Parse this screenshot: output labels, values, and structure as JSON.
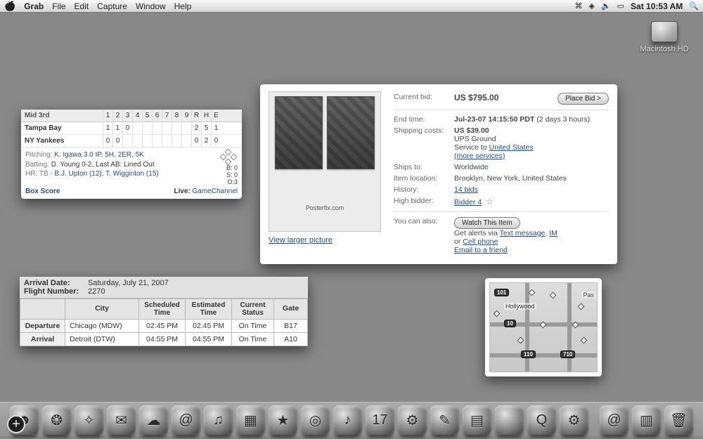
{
  "menubar": {
    "app": "Grab",
    "items": [
      "File",
      "Edit",
      "Capture",
      "Window",
      "Help"
    ],
    "clock": "Sat 10:53 AM"
  },
  "desktop": {
    "hd_label": "Macintosh HD"
  },
  "sports": {
    "status": "Mid 3rd",
    "inning_labels": [
      "1",
      "2",
      "3",
      "4",
      "5",
      "6",
      "7",
      "8",
      "9",
      "R",
      "H",
      "E"
    ],
    "teams": [
      {
        "name": "Tampa Bay",
        "cells": [
          "1",
          "1",
          "0",
          "",
          "",
          "",
          "",
          "",
          "",
          "2",
          "5",
          "1"
        ]
      },
      {
        "name": "NY Yankees",
        "cells": [
          "0",
          "0",
          "",
          "",
          "",
          "",
          "",
          "",
          "",
          "0",
          "2",
          "0"
        ]
      }
    ],
    "bso": {
      "b": "B: 0",
      "s": "S: 0",
      "o": "O:3"
    },
    "pitching_label": "Pitching:",
    "pitching": "K. Igawa 3.0 IP, 5H, 2ER, 5K",
    "batting_label": "Batting:",
    "batting": "D. Young 0-2, Last AB: Lined Out",
    "hr_label": "HR: TB -",
    "hr": "B.J. Upton (12), T. Wigginton (15)",
    "boxscore": "Box Score",
    "live_label": "Live:",
    "live_link": "GameChannel"
  },
  "auction": {
    "poster_caption": "Posterfix.com",
    "view_larger": "View larger picture",
    "currentbid_label": "Current bid:",
    "currentbid": "US $795.00",
    "placebid": "Place Bid >",
    "end_label": "End time:",
    "end_value": "Jul-23-07 14:15:50 PDT",
    "end_remaining": "(2 days 3 hours)",
    "ship_label": "Shipping costs:",
    "ship_cost": "US $39.00",
    "ship_svc": "UPS Ground",
    "ship_to_label": "Service to",
    "ship_to_link": "United States",
    "more_svc": "(more services)",
    "shipsto_label": "Ships to:",
    "shipsto": "Worldwide",
    "loc_label": "Item location:",
    "loc": "Brooklyn, New York, United States",
    "history_label": "History:",
    "history": "14 bids",
    "high_label": "High bidder:",
    "high": "Bidder 4",
    "also_label": "You can also:",
    "watch": "Watch This Item",
    "alerts_a": "Get alerts via ",
    "alerts_text": "Text message",
    "alerts_sep": ", ",
    "alerts_im": "IM",
    "alerts_or": "or ",
    "alerts_cell": "Cell phone",
    "email_friend": "Email to a friend"
  },
  "flight": {
    "date_label": "Arrival Date:",
    "date": "Saturday, July 21, 2007",
    "num_label": "Flight Number:",
    "num": "2270",
    "cols": [
      "",
      "City",
      "Scheduled Time",
      "Estimated Time",
      "Current Status",
      "Gate"
    ],
    "rows": [
      {
        "hdr": "Departure",
        "city": "Chicago (MDW)",
        "sched": "02:45 PM",
        "est": "02:45 PM",
        "status": "On Time",
        "gate": "B17"
      },
      {
        "hdr": "Arrival",
        "city": "Detroit (DTW)",
        "sched": "04:55 PM",
        "est": "04:55 PM",
        "status": "On Time",
        "gate": "A10"
      }
    ]
  },
  "map": {
    "labels": {
      "hollywood": "Hollywood",
      "pas": "Pas"
    },
    "shields": {
      "s101": "101",
      "s10": "10",
      "s110": "110",
      "s710": "710"
    }
  },
  "dock": {
    "apps": [
      {
        "n": "finder",
        "g": "☻"
      },
      {
        "n": "dashboard",
        "g": "❂"
      },
      {
        "n": "safari",
        "g": "✧"
      },
      {
        "n": "mail",
        "g": "✉"
      },
      {
        "n": "ichat",
        "g": "☁"
      },
      {
        "n": "addressbook",
        "g": "@"
      },
      {
        "n": "itunes",
        "g": "♫"
      },
      {
        "n": "iphoto",
        "g": "▦"
      },
      {
        "n": "imovie",
        "g": "★"
      },
      {
        "n": "idvd",
        "g": "◎"
      },
      {
        "n": "garageband",
        "g": "♪"
      },
      {
        "n": "ical",
        "g": "17"
      },
      {
        "n": "automator",
        "g": "⚙"
      },
      {
        "n": "textedit",
        "g": "✎"
      },
      {
        "n": "preview",
        "g": "▤"
      },
      {
        "n": "pages",
        "g": ""
      },
      {
        "n": "quicktime",
        "g": "Q"
      },
      {
        "n": "sysprefs",
        "g": "⚙"
      }
    ],
    "right": [
      {
        "n": "site",
        "g": "@"
      },
      {
        "n": "docs",
        "g": "▥"
      },
      {
        "n": "trash",
        "g": "🗑"
      }
    ]
  }
}
